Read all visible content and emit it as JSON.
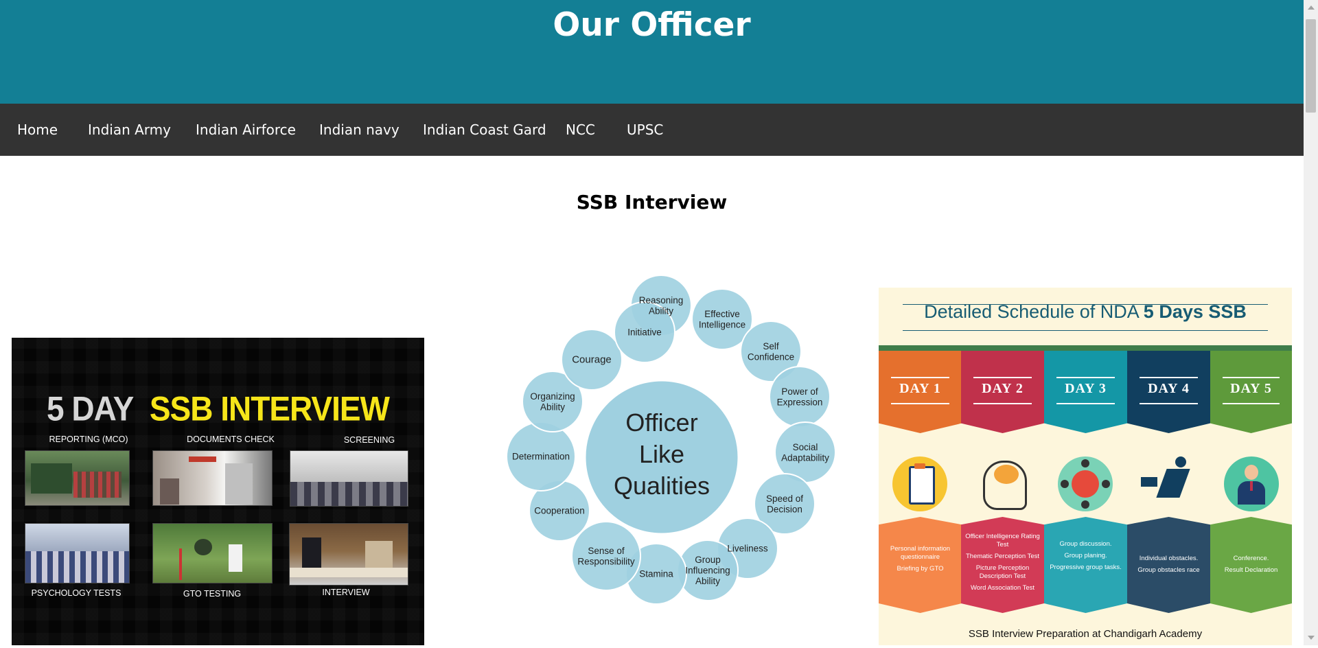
{
  "header": {
    "title": "Our Officer",
    "bg_color": "#137f95"
  },
  "nav": {
    "bg_color": "#333333",
    "items": [
      {
        "label": "Home"
      },
      {
        "label": "Indian Army"
      },
      {
        "label": "Indian Airforce"
      },
      {
        "label": "Indian navy"
      },
      {
        "label": "Indian Coast Gard"
      },
      {
        "label": "NCC"
      },
      {
        "label": "UPSC"
      }
    ]
  },
  "main": {
    "section_title": "SSB Interview",
    "image_left": {
      "title_part1": "5 DAY",
      "title_part2": "SSB INTERVIEW",
      "labels": [
        "REPORTING (MCO)",
        "DOCUMENTS CHECK",
        "SCREENING",
        "PSYCHOLOGY TESTS",
        "GTO TESTING",
        "INTERVIEW"
      ]
    },
    "olq_diagram": {
      "center_line1": "Officer",
      "center_line2": "Like",
      "center_line3": "Qualities",
      "qualities": [
        "Reasoning Ability",
        "Effective Intelligence",
        "Self Confidence",
        "Power of Expression",
        "Social Adaptability",
        "Speed of Decision",
        "Liveliness",
        "Group Influencing Ability",
        "Stamina",
        "Sense of Responsibility",
        "Cooperation",
        "Determination",
        "Organizing Ability",
        "Courage",
        "Initiative"
      ],
      "circle_color": "#9fd0e0"
    },
    "image_right": {
      "title_normal": "Detailed Schedule of NDA",
      "title_bold": "5 Days SSB",
      "days": [
        {
          "label": "DAY 1",
          "lines": [
            "Personal information questionnaire",
            "Briefing by GTO"
          ],
          "top_color": "#e5702d",
          "bottom_color": "#f5874a"
        },
        {
          "label": "DAY 2",
          "lines": [
            "Officer Intelligence Rating Test",
            "Thematic Perception Test",
            "Picture Perception Description Test",
            "Word Association Test"
          ],
          "top_color": "#c0314b",
          "bottom_color": "#d23b56"
        },
        {
          "label": "DAY 3",
          "lines": [
            "Group discussion.",
            "Group planing.",
            "Progressive group tasks."
          ],
          "top_color": "#1497a6",
          "bottom_color": "#2aa6b3"
        },
        {
          "label": "DAY 4",
          "lines": [
            "Individual obstacles.",
            "Group obstacles race"
          ],
          "top_color": "#113f5f",
          "bottom_color": "#2b4c67"
        },
        {
          "label": "DAY 5",
          "lines": [
            "Conference.",
            "Result Declaration"
          ],
          "top_color": "#5e9a3b",
          "bottom_color": "#6aa745"
        }
      ],
      "footer": "SSB Interview Preparation at Chandigarh Academy"
    }
  }
}
